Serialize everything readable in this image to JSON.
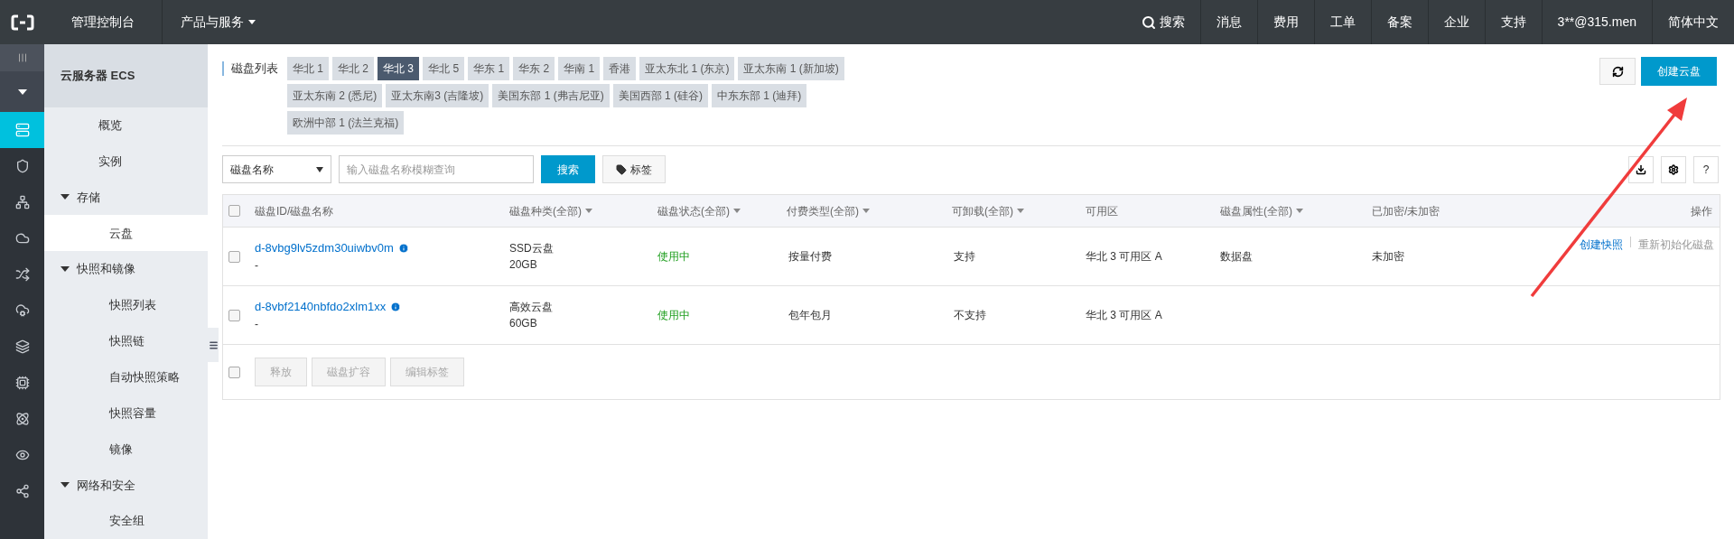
{
  "top_nav": {
    "title": "管理控制台",
    "products": "产品与服务",
    "items": [
      {
        "label": "搜索",
        "kind": "search"
      },
      {
        "label": "消息",
        "kind": "plain"
      },
      {
        "label": "费用",
        "kind": "plain"
      },
      {
        "label": "工单",
        "kind": "plain"
      },
      {
        "label": "备案",
        "kind": "plain"
      },
      {
        "label": "企业",
        "kind": "plain"
      },
      {
        "label": "支持",
        "kind": "plain"
      },
      {
        "label": "3**@315.men",
        "kind": "plain"
      },
      {
        "label": "简体中文",
        "kind": "plain"
      }
    ]
  },
  "rail": [
    {
      "selected": true
    },
    {
      "selected": false
    },
    {
      "selected": false
    },
    {
      "selected": false
    },
    {
      "selected": false
    },
    {
      "selected": false
    },
    {
      "selected": false
    },
    {
      "selected": false
    },
    {
      "selected": false
    },
    {
      "selected": false
    },
    {
      "selected": false
    }
  ],
  "sidebar": {
    "title": "云服务器 ECS",
    "items": [
      {
        "label": "概览",
        "selected": false
      },
      {
        "label": "实例",
        "selected": false
      },
      {
        "label": "存储",
        "selected": false,
        "expanded": true,
        "children": [
          {
            "label": "云盘",
            "selected": true
          }
        ]
      },
      {
        "label": "快照和镜像",
        "selected": false,
        "expanded": true,
        "children": [
          {
            "label": "快照列表",
            "selected": false
          },
          {
            "label": "快照链",
            "selected": false
          },
          {
            "label": "自动快照策略",
            "selected": false
          },
          {
            "label": "快照容量",
            "selected": false
          },
          {
            "label": "镜像",
            "selected": false
          }
        ]
      },
      {
        "label": "网络和安全",
        "selected": false,
        "expanded": true,
        "children": [
          {
            "label": "安全组",
            "selected": false
          }
        ]
      }
    ]
  },
  "disk_list": {
    "label": "磁盘列表",
    "create_button": "创建云盘",
    "regions": [
      {
        "label": "华北 1",
        "selected": false
      },
      {
        "label": "华北 2",
        "selected": false
      },
      {
        "label": "华北 3",
        "selected": true
      },
      {
        "label": "华北 5",
        "selected": false
      },
      {
        "label": "华东 1",
        "selected": false
      },
      {
        "label": "华东 2",
        "selected": false
      },
      {
        "label": "华南 1",
        "selected": false
      },
      {
        "label": "香港",
        "selected": false
      },
      {
        "label": "亚太东北 1 (东京)",
        "selected": false
      },
      {
        "label": "亚太东南 1 (新加坡)",
        "selected": false
      },
      {
        "label": "亚太东南 2 (悉尼)",
        "selected": false
      },
      {
        "label": "亚太东南3 (吉隆坡)",
        "selected": false
      },
      {
        "label": "美国东部 1 (弗吉尼亚)",
        "selected": false
      },
      {
        "label": "美国西部 1 (硅谷)",
        "selected": false
      },
      {
        "label": "中东东部 1 (迪拜)",
        "selected": false
      },
      {
        "label": "欧洲中部 1 (法兰克福)",
        "selected": false
      }
    ]
  },
  "filter": {
    "help_button": "?",
    "field": "磁盘名称",
    "placeholder": "输入磁盘名称模糊查询",
    "search_button": "搜索",
    "tag_button": "标签"
  },
  "table": {
    "header_checked": false,
    "columns": [
      {
        "label": "磁盘ID/磁盘名称",
        "filter": false
      },
      {
        "label": "磁盘种类(全部)",
        "filter": true
      },
      {
        "label": "磁盘状态(全部)",
        "filter": true
      },
      {
        "label": "付费类型(全部)",
        "filter": true
      },
      {
        "label": "可卸载(全部)",
        "filter": true
      },
      {
        "label": "可用区",
        "filter": false
      },
      {
        "label": "磁盘属性(全部)",
        "filter": true
      },
      {
        "label": "已加密/未加密",
        "filter": false
      },
      {
        "label": "操作",
        "filter": false
      }
    ],
    "rows": [
      {
        "checked": false,
        "id": "d-8vbg9lv5zdm30uiwbv0m",
        "name": "-",
        "type": "SSD云盘",
        "size": "20GB",
        "status": "使用中",
        "billing": "按量付费",
        "detachable": "支持",
        "zone": "华北 3 可用区 A",
        "attribute": "数据盘",
        "encryption": "未加密",
        "actions": [
          "创建快照",
          "重新初始化磁盘"
        ]
      },
      {
        "checked": false,
        "id": "d-8vbf2140nbfdo2xlm1xx",
        "name": "-",
        "type": "高效云盘",
        "size": "60GB",
        "status": "使用中",
        "billing": "包年包月",
        "detachable": "不支持",
        "zone": "华北 3 可用区 A",
        "actions": []
      }
    ],
    "footer_checked": false,
    "footer_buttons": [
      {
        "label": "释放",
        "disabled": true
      },
      {
        "label": "磁盘扩容",
        "disabled": true
      },
      {
        "label": "编辑标签",
        "disabled": true
      }
    ]
  }
}
